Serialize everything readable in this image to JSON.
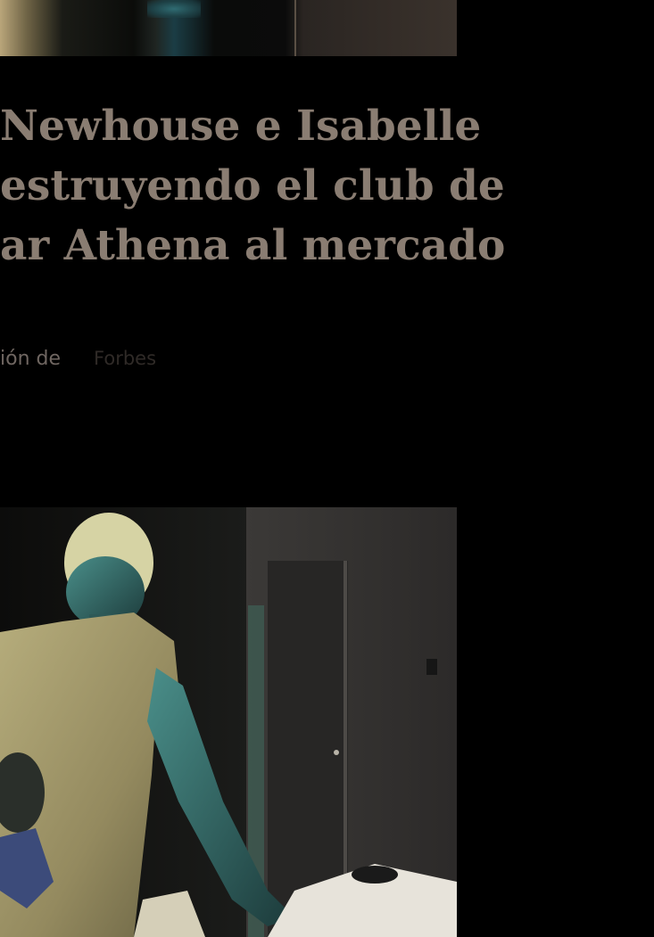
{
  "article": {
    "headline_lines": [
      "Newhouse e Isabelle",
      "estruyendo el club de",
      "ar Athena al mercado"
    ],
    "byline": {
      "prefix": "ión de",
      "source": "Forbes"
    }
  },
  "images": {
    "top": "cropped-photo",
    "main": "man-holding-baby-photo"
  }
}
